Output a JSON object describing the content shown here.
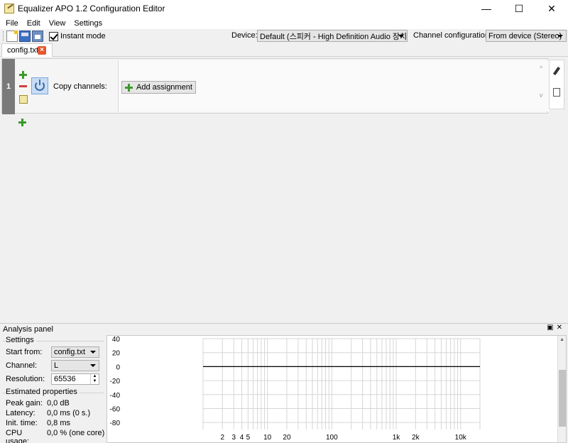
{
  "window": {
    "title": "Equalizer APO 1.2 Configuration Editor",
    "minimize": "—",
    "maximize": "☐",
    "close": "✕"
  },
  "menu": [
    "File",
    "Edit",
    "View",
    "Settings"
  ],
  "toolbar": {
    "instant_mode_label": "Instant mode",
    "instant_mode_checked": true,
    "device_label": "Device:",
    "device_value": "Default (스피커 - High Definition Audio 장치)",
    "channel_config_label": "Channel configuration:",
    "channel_config_value": "From device (Stereo)"
  },
  "tabs": [
    {
      "label": "config.txt",
      "close": "×"
    }
  ],
  "filter": {
    "row_number": "1",
    "title": "Copy channels:",
    "add_assignment_label": "Add assignment",
    "scroll_up": "^",
    "scroll_down": "v"
  },
  "analysis": {
    "header_title": "Analysis panel",
    "header_buttons": "▣✕",
    "settings_group": "Settings",
    "start_from_label": "Start from:",
    "start_from_value": "config.txt",
    "channel_label": "Channel:",
    "channel_value": "L",
    "resolution_label": "Resolution:",
    "resolution_value": "65536",
    "estimated_group": "Estimated properties",
    "peak_gain_label": "Peak gain:",
    "peak_gain_value": "0,0 dB",
    "latency_label": "Latency:",
    "latency_value": "0,0 ms (0 s.)",
    "init_time_label": "Init. time:",
    "init_time_value": "0,8 ms",
    "cpu_label": "CPU usage:",
    "cpu_value": "0,0 % (one core)"
  },
  "chart_data": {
    "type": "line",
    "title": "",
    "xlabel": "",
    "ylabel": "",
    "xscale": "log",
    "xlim": [
      1,
      20000
    ],
    "ylim": [
      -90,
      40
    ],
    "y_ticks": [
      "40",
      "20",
      "0",
      "-20",
      "-40",
      "-60",
      "-80"
    ],
    "x_ticks": [
      "2",
      "3",
      "4",
      "5",
      "10",
      "20",
      "100",
      "1k",
      "2k",
      "10k"
    ],
    "grid": true,
    "series": [
      {
        "x": [
          1,
          20000
        ],
        "y": [
          0,
          0
        ]
      }
    ]
  }
}
